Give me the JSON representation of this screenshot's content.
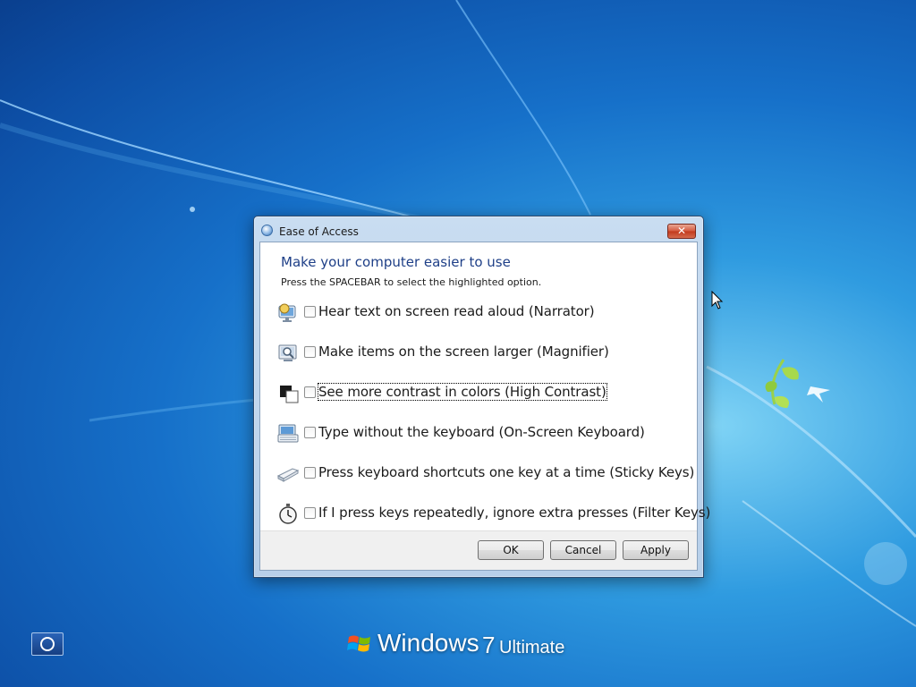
{
  "dialog": {
    "title": "Ease of Access",
    "heading": "Make your computer easier to use",
    "instruction": "Press the SPACEBAR to select the highlighted option.",
    "options": [
      {
        "label": "Hear text on screen read aloud (Narrator)",
        "icon": "narrator-icon",
        "checked": false
      },
      {
        "label": "Make items on the screen larger (Magnifier)",
        "icon": "magnifier-icon",
        "checked": false
      },
      {
        "label": "See more contrast in colors (High Contrast)",
        "icon": "high-contrast-icon",
        "checked": false,
        "focused": true
      },
      {
        "label": "Type without the keyboard (On-Screen Keyboard)",
        "icon": "on-screen-keyboard-icon",
        "checked": false
      },
      {
        "label": "Press keyboard shortcuts one key at a time (Sticky Keys)",
        "icon": "sticky-keys-icon",
        "checked": false
      },
      {
        "label": "If I press keys repeatedly, ignore extra presses (Filter Keys)",
        "icon": "filter-keys-icon",
        "checked": false
      }
    ],
    "buttons": {
      "ok": "OK",
      "cancel": "Cancel",
      "apply": "Apply"
    },
    "close_symbol": "✕"
  },
  "desktop": {
    "branding": {
      "windows": "Windows",
      "version": "7",
      "edition": "Ultimate"
    },
    "ease_of_access_button_icon": "ease-of-access-icon"
  },
  "colors": {
    "heading": "#1e3f87",
    "desktop_blue": "#1670c9",
    "close_red": "#c1391c"
  }
}
